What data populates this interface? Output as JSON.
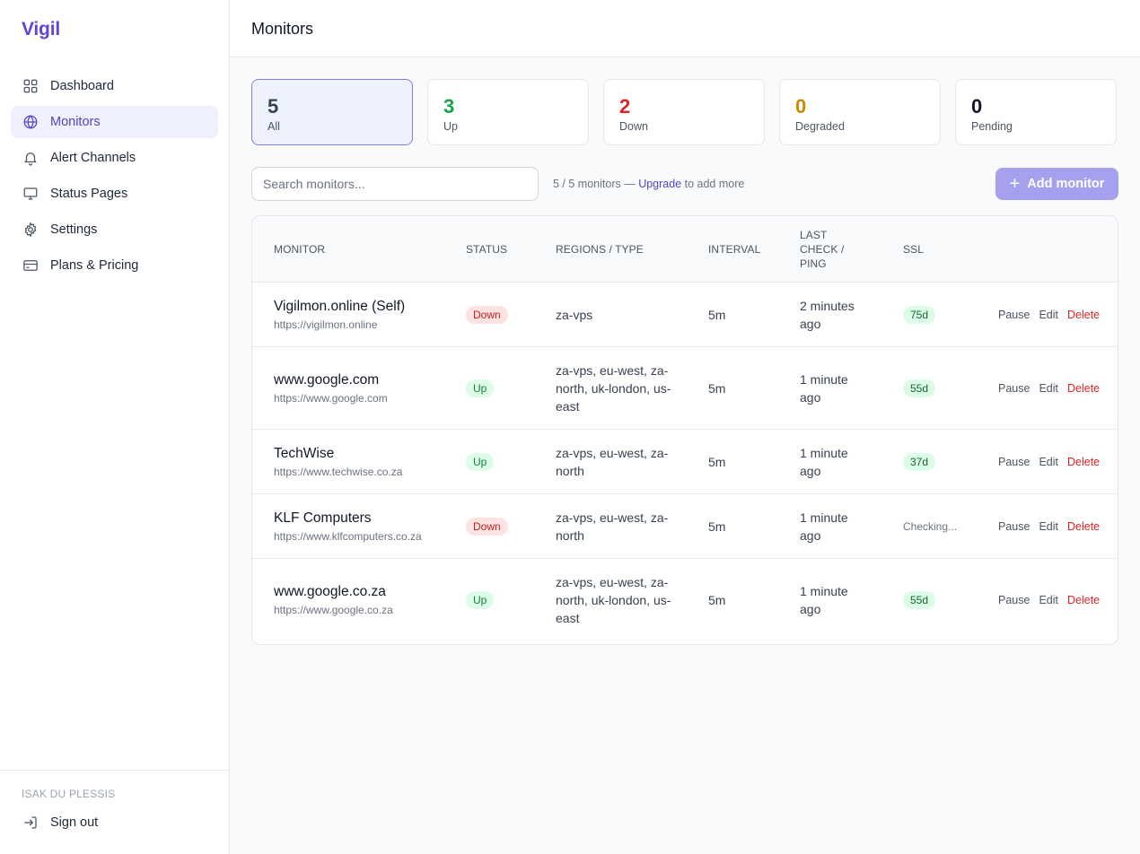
{
  "app": {
    "logo": "Vigil"
  },
  "sidebar": {
    "items": [
      {
        "label": "Dashboard",
        "icon": "grid-icon"
      },
      {
        "label": "Monitors",
        "icon": "globe-icon",
        "active": true
      },
      {
        "label": "Alert Channels",
        "icon": "bell-icon"
      },
      {
        "label": "Status Pages",
        "icon": "monitor-icon"
      },
      {
        "label": "Settings",
        "icon": "gear-icon"
      },
      {
        "label": "Plans & Pricing",
        "icon": "credit-card-icon"
      }
    ],
    "user_name": "ISAK DU PLESSIS",
    "sign_out": "Sign out"
  },
  "header": {
    "title": "Monitors"
  },
  "stats": [
    {
      "count": "5",
      "label": "All",
      "color": "#374151",
      "active": true
    },
    {
      "count": "3",
      "label": "Up",
      "color": "#16a34a"
    },
    {
      "count": "2",
      "label": "Down",
      "color": "#dc2626"
    },
    {
      "count": "0",
      "label": "Degraded",
      "color": "#ca8a04"
    },
    {
      "count": "0",
      "label": "Pending",
      "color": "#111827"
    }
  ],
  "toolbar": {
    "search_placeholder": "Search monitors...",
    "quota_text": "5 / 5 monitors —",
    "upgrade_link": "Upgrade",
    "quota_suffix": "to add more",
    "add_button": "Add monitor"
  },
  "table": {
    "columns": {
      "monitor": "Monitor",
      "status": "Status",
      "regions": "Regions / Type",
      "interval": "Interval",
      "last_check": "Last check / ping",
      "ssl": "SSL"
    },
    "actions": {
      "pause": "Pause",
      "edit": "Edit",
      "delete": "Delete"
    },
    "rows": [
      {
        "name": "Vigilmon.online (Self)",
        "url": "https://vigilmon.online",
        "status": "Down",
        "regions": "za-vps",
        "interval": "5m",
        "last_check": "2 minutes ago",
        "ssl": "75d"
      },
      {
        "name": "www.google.com",
        "url": "https://www.google.com",
        "status": "Up",
        "regions": "za-vps, eu-west, za-north, uk-london, us-east",
        "interval": "5m",
        "last_check": "1 minute ago",
        "ssl": "55d"
      },
      {
        "name": "TechWise",
        "url": "https://www.techwise.co.za",
        "status": "Up",
        "regions": "za-vps, eu-west, za-north",
        "interval": "5m",
        "last_check": "1 minute ago",
        "ssl": "37d"
      },
      {
        "name": "KLF Computers",
        "url": "https://www.klfcomputers.co.za",
        "status": "Down",
        "regions": "za-vps, eu-west, za-north",
        "interval": "5m",
        "last_check": "1 minute ago",
        "ssl": "Checking..."
      },
      {
        "name": "www.google.co.za",
        "url": "https://www.google.co.za",
        "status": "Up",
        "regions": "za-vps, eu-west, za-north, uk-london, us-east",
        "interval": "5m",
        "last_check": "1 minute ago",
        "ssl": "55d"
      }
    ]
  }
}
